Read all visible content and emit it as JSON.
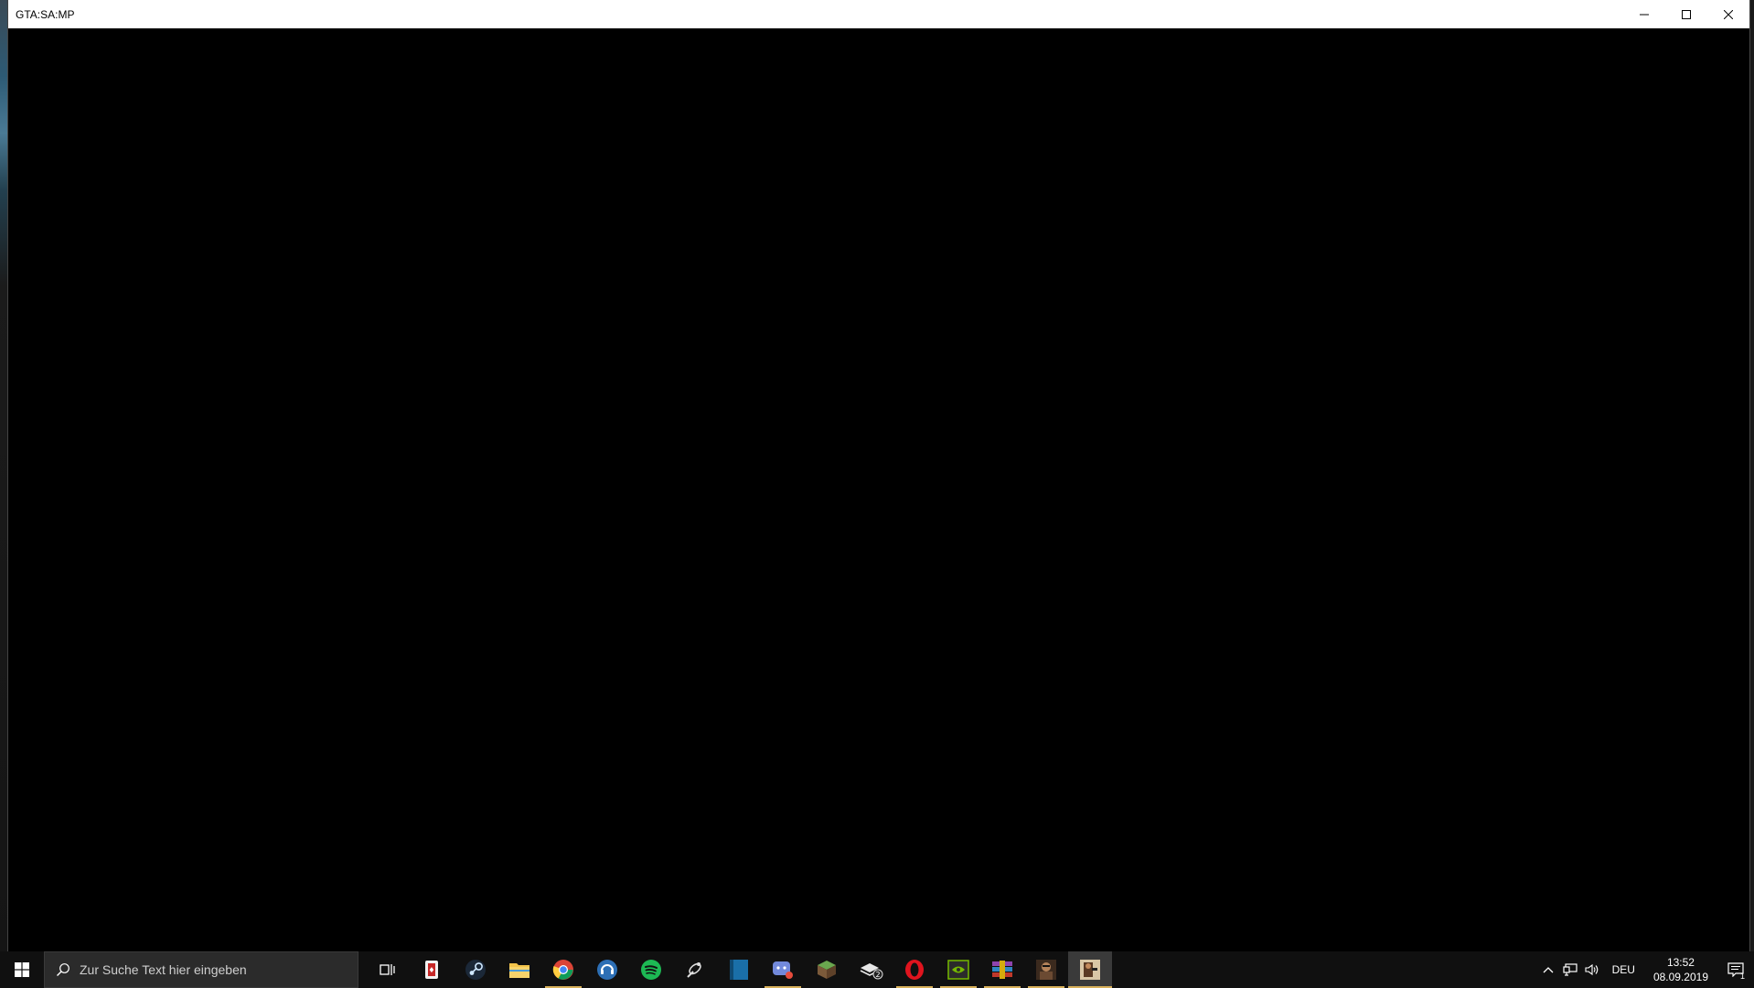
{
  "window": {
    "title": "GTA:SA:MP",
    "controls": {
      "minimize_icon": "minimize-icon",
      "maximize_icon": "maximize-icon",
      "close_icon": "close-icon"
    }
  },
  "taskbar": {
    "search_placeholder": "Zur Suche Text hier eingeben",
    "apps": [
      {
        "name": "solitaire",
        "running": false
      },
      {
        "name": "steam",
        "running": false
      },
      {
        "name": "file-explorer",
        "running": false
      },
      {
        "name": "chrome",
        "running": true
      },
      {
        "name": "teamspeak",
        "running": false
      },
      {
        "name": "spotify",
        "running": false
      },
      {
        "name": "satellite",
        "running": false
      },
      {
        "name": "blue-app",
        "running": false
      },
      {
        "name": "discord",
        "running": true
      },
      {
        "name": "minecraft",
        "running": false
      },
      {
        "name": "stack-app",
        "running": false,
        "badge": "2"
      },
      {
        "name": "opera",
        "running": true
      },
      {
        "name": "nvidia",
        "running": true
      },
      {
        "name": "winrar",
        "running": true
      },
      {
        "name": "gta-sa",
        "running": true
      },
      {
        "name": "gta-samp",
        "running": true,
        "active": true
      }
    ],
    "language": "DEU",
    "time": "13:52",
    "date": "08.09.2019",
    "notification_count": "1"
  },
  "colors": {
    "taskbar_bg": "#101010",
    "running_indicator": "#d8b05a",
    "titlebar_bg": "#ffffff"
  }
}
